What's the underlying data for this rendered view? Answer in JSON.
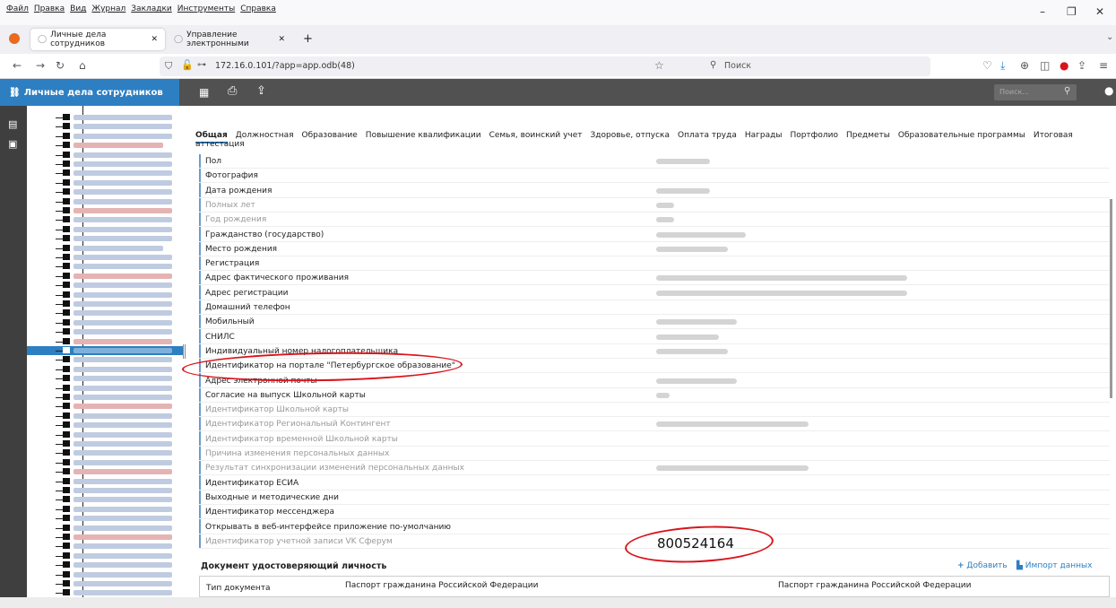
{
  "browser": {
    "menu": [
      "Файл",
      "Правка",
      "Вид",
      "Журнал",
      "Закладки",
      "Инструменты",
      "Справка"
    ],
    "tabs": [
      "Личные дела сотрудников",
      "Управление электронными"
    ],
    "url": "172.16.0.101/?app=app.odb(48)",
    "search_placeholder": "Поиск"
  },
  "app": {
    "title": "Личные дела сотрудников",
    "search_placeholder": "Поиск..."
  },
  "tabs": [
    "Общая",
    "Должностная",
    "Образование",
    "Повышение квалификации",
    "Семья, воинский учет",
    "Здоровье, отпуска",
    "Оплата труда",
    "Награды",
    "Портфолио",
    "Предметы",
    "Образовательные программы",
    "Итоговая аттестация"
  ],
  "fields": [
    {
      "label": "Пол",
      "grey": false
    },
    {
      "label": "Фотография",
      "grey": false
    },
    {
      "label": "Дата рождения",
      "grey": false
    },
    {
      "label": "Полных лет",
      "grey": true
    },
    {
      "label": "Год рождения",
      "grey": true
    },
    {
      "label": "Гражданство (государство)",
      "grey": false
    },
    {
      "label": "Место рождения",
      "grey": false
    },
    {
      "label": "Регистрация",
      "grey": false
    },
    {
      "label": "Адрес фактического проживания",
      "grey": false
    },
    {
      "label": "Адрес регистрации",
      "grey": false
    },
    {
      "label": "Домашний телефон",
      "grey": false
    },
    {
      "label": "Мобильный",
      "grey": false
    },
    {
      "label": "СНИЛС",
      "grey": false
    },
    {
      "label": "Индивидуальный номер налогоплательщика",
      "grey": false
    },
    {
      "label": "Идентификатор на портале \"Петербургское образование\"",
      "grey": false
    },
    {
      "label": "Адрес электронной почты",
      "grey": false
    },
    {
      "label": "Согласие на выпуск Школьной карты",
      "grey": false
    },
    {
      "label": "Идентификатор Школьной карты",
      "grey": true
    },
    {
      "label": "Идентификатор Региональный Контингент",
      "grey": true
    },
    {
      "label": "Идентификатор временной Школьной карты",
      "grey": true
    },
    {
      "label": "Причина изменения персональных данных",
      "grey": true
    },
    {
      "label": "Результат синхронизации изменений персональных данных",
      "grey": true
    },
    {
      "label": "Идентификатор ЕСИА",
      "grey": false
    },
    {
      "label": "Выходные и методические дни",
      "grey": false
    },
    {
      "label": "Идентификатор мессенджера",
      "grey": false
    },
    {
      "label": "Открывать в веб-интерфейсе приложение по-умолчанию",
      "grey": false
    },
    {
      "label": "Идентификатор учетной записи VK Сферум",
      "grey": true
    }
  ],
  "annotation_number": "800524164",
  "doc_section": {
    "title": "Документ удостоверяющий личность",
    "add_label": "Добавить",
    "import_label": "Импорт данных",
    "col_label": "Тип документа",
    "doc_type": "Паспорт гражданина Российской Федерации",
    "doc_type_2": "Паспорт гражданина Российской Федерации"
  },
  "colors": {
    "accent": "#2d7fc1",
    "header": "#515151",
    "annotation": "#d9141b"
  }
}
